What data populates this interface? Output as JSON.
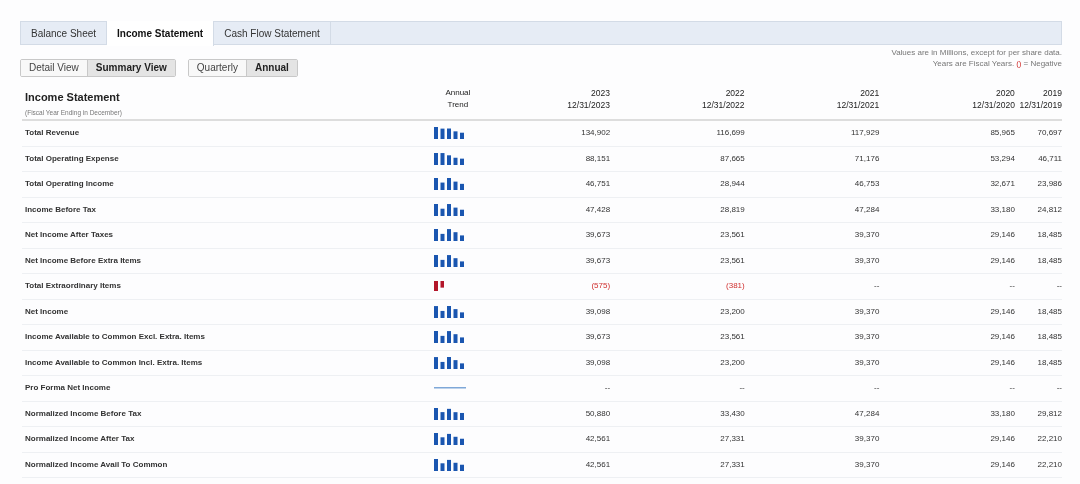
{
  "tabs": [
    {
      "label": "Balance Sheet",
      "selected": false
    },
    {
      "label": "Income Statement",
      "selected": true
    },
    {
      "label": "Cash Flow Statement",
      "selected": false
    }
  ],
  "view_toggle": [
    {
      "label": "Detail View",
      "selected": false
    },
    {
      "label": "Summary View",
      "selected": true
    }
  ],
  "period_toggle": [
    {
      "label": "Quarterly",
      "selected": false
    },
    {
      "label": "Annual",
      "selected": true
    }
  ],
  "note": {
    "line_1": "Values are in Millions, except for per share data.",
    "line_2": "Years are Fiscal Years.",
    "negative_mark": "()",
    "line_2_end": "= Negative"
  },
  "table": {
    "title": "Income Statement",
    "subtitle": "(Fiscal Year Ending in December)",
    "trend_heading": [
      "Annual",
      "Trend"
    ],
    "columns": [
      {
        "year": "2023",
        "date": "12/31/2023"
      },
      {
        "year": "2022",
        "date": "12/31/2022"
      },
      {
        "year": "2021",
        "date": "12/31/2021"
      },
      {
        "year": "2020",
        "date": "12/31/2020"
      },
      {
        "year": "2019",
        "date": "12/31/2019"
      }
    ],
    "rows": [
      {
        "label": "Total Revenue",
        "cells": [
          {
            "text": "134,902",
            "negative": false
          },
          {
            "text": "116,699",
            "negative": false
          },
          {
            "text": "117,929",
            "negative": false
          },
          {
            "text": "85,965",
            "negative": false
          },
          {
            "text": "70,697",
            "negative": false
          }
        ]
      },
      {
        "label": "Total Operating Expense",
        "cells": [
          {
            "text": "88,151",
            "negative": false
          },
          {
            "text": "87,665",
            "negative": false
          },
          {
            "text": "71,176",
            "negative": false
          },
          {
            "text": "53,294",
            "negative": false
          },
          {
            "text": "46,711",
            "negative": false
          }
        ]
      },
      {
        "label": "Total Operating Income",
        "cells": [
          {
            "text": "46,751",
            "negative": false
          },
          {
            "text": "28,944",
            "negative": false
          },
          {
            "text": "46,753",
            "negative": false
          },
          {
            "text": "32,671",
            "negative": false
          },
          {
            "text": "23,986",
            "negative": false
          }
        ]
      },
      {
        "label": "Income Before Tax",
        "cells": [
          {
            "text": "47,428",
            "negative": false
          },
          {
            "text": "28,819",
            "negative": false
          },
          {
            "text": "47,284",
            "negative": false
          },
          {
            "text": "33,180",
            "negative": false
          },
          {
            "text": "24,812",
            "negative": false
          }
        ]
      },
      {
        "label": "Net Income After Taxes",
        "cells": [
          {
            "text": "39,673",
            "negative": false
          },
          {
            "text": "23,561",
            "negative": false
          },
          {
            "text": "39,370",
            "negative": false
          },
          {
            "text": "29,146",
            "negative": false
          },
          {
            "text": "18,485",
            "negative": false
          }
        ]
      },
      {
        "label": "Net Income Before Extra Items",
        "cells": [
          {
            "text": "39,673",
            "negative": false
          },
          {
            "text": "23,561",
            "negative": false
          },
          {
            "text": "39,370",
            "negative": false
          },
          {
            "text": "29,146",
            "negative": false
          },
          {
            "text": "18,485",
            "negative": false
          }
        ]
      },
      {
        "label": "Total Extraordinary Items",
        "cells": [
          {
            "text": "(575)",
            "negative": true
          },
          {
            "text": "(381)",
            "negative": true
          },
          {
            "text": "--",
            "negative": false
          },
          {
            "text": "--",
            "negative": false
          },
          {
            "text": "--",
            "negative": false
          }
        ]
      },
      {
        "label": "Net Income",
        "cells": [
          {
            "text": "39,098",
            "negative": false
          },
          {
            "text": "23,200",
            "negative": false
          },
          {
            "text": "39,370",
            "negative": false
          },
          {
            "text": "29,146",
            "negative": false
          },
          {
            "text": "18,485",
            "negative": false
          }
        ]
      },
      {
        "label": "Income Available to Common Excl. Extra. Items",
        "cells": [
          {
            "text": "39,673",
            "negative": false
          },
          {
            "text": "23,561",
            "negative": false
          },
          {
            "text": "39,370",
            "negative": false
          },
          {
            "text": "29,146",
            "negative": false
          },
          {
            "text": "18,485",
            "negative": false
          }
        ]
      },
      {
        "label": "Income Available to Common Incl. Extra. Items",
        "cells": [
          {
            "text": "39,098",
            "negative": false
          },
          {
            "text": "23,200",
            "negative": false
          },
          {
            "text": "39,370",
            "negative": false
          },
          {
            "text": "29,146",
            "negative": false
          },
          {
            "text": "18,485",
            "negative": false
          }
        ]
      },
      {
        "label": "Pro Forma Net Income",
        "cells": [
          {
            "text": "--",
            "negative": false
          },
          {
            "text": "--",
            "negative": false
          },
          {
            "text": "--",
            "negative": false
          },
          {
            "text": "--",
            "negative": false
          },
          {
            "text": "--",
            "negative": false
          }
        ]
      },
      {
        "label": "Normalized Income Before Tax",
        "cells": [
          {
            "text": "50,880",
            "negative": false
          },
          {
            "text": "33,430",
            "negative": false
          },
          {
            "text": "47,284",
            "negative": false
          },
          {
            "text": "33,180",
            "negative": false
          },
          {
            "text": "29,812",
            "negative": false
          }
        ]
      },
      {
        "label": "Normalized Income After Tax",
        "cells": [
          {
            "text": "42,561",
            "negative": false
          },
          {
            "text": "27,331",
            "negative": false
          },
          {
            "text": "39,370",
            "negative": false
          },
          {
            "text": "29,146",
            "negative": false
          },
          {
            "text": "22,210",
            "negative": false
          }
        ]
      },
      {
        "label": "Normalized Income Avail To Common",
        "cells": [
          {
            "text": "42,561",
            "negative": false
          },
          {
            "text": "27,331",
            "negative": false
          },
          {
            "text": "39,370",
            "negative": false
          },
          {
            "text": "29,146",
            "negative": false
          },
          {
            "text": "22,210",
            "negative": false
          }
        ]
      }
    ]
  }
}
